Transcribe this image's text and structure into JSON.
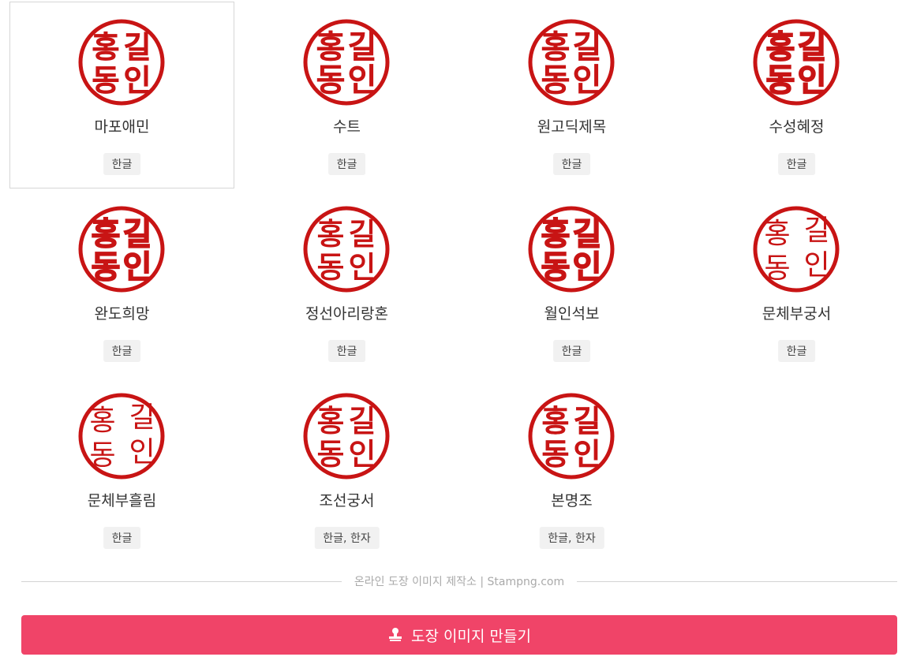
{
  "stamp_text": [
    "홍",
    "길",
    "동",
    "인"
  ],
  "stamp_color": "#c81414",
  "fonts": [
    {
      "name": "마포애민",
      "tag": "한글",
      "selected": true,
      "style": "rounded"
    },
    {
      "name": "수트",
      "tag": "한글",
      "style": "bold"
    },
    {
      "name": "원고딕제목",
      "tag": "한글",
      "style": "bold"
    },
    {
      "name": "수성혜정",
      "tag": "한글",
      "style": "heavy"
    },
    {
      "name": "완도희망",
      "tag": "한글",
      "style": "heavy"
    },
    {
      "name": "정선아리랑혼",
      "tag": "한글",
      "style": "brush"
    },
    {
      "name": "월인석보",
      "tag": "한글",
      "style": "heavy"
    },
    {
      "name": "문체부궁서",
      "tag": "한글",
      "style": "thin"
    },
    {
      "name": "문체부흘림",
      "tag": "한글",
      "style": "thin"
    },
    {
      "name": "조선궁서",
      "tag": "한글, 한자",
      "style": "brush"
    },
    {
      "name": "본명조",
      "tag": "한글, 한자",
      "style": "serif"
    }
  ],
  "footer": {
    "divider_text": "온라인 도장 이미지 제작소 | Stampng.com",
    "button_label": "도장 이미지 만들기",
    "button_icon": "stamp-icon",
    "button_color": "#f04468"
  }
}
